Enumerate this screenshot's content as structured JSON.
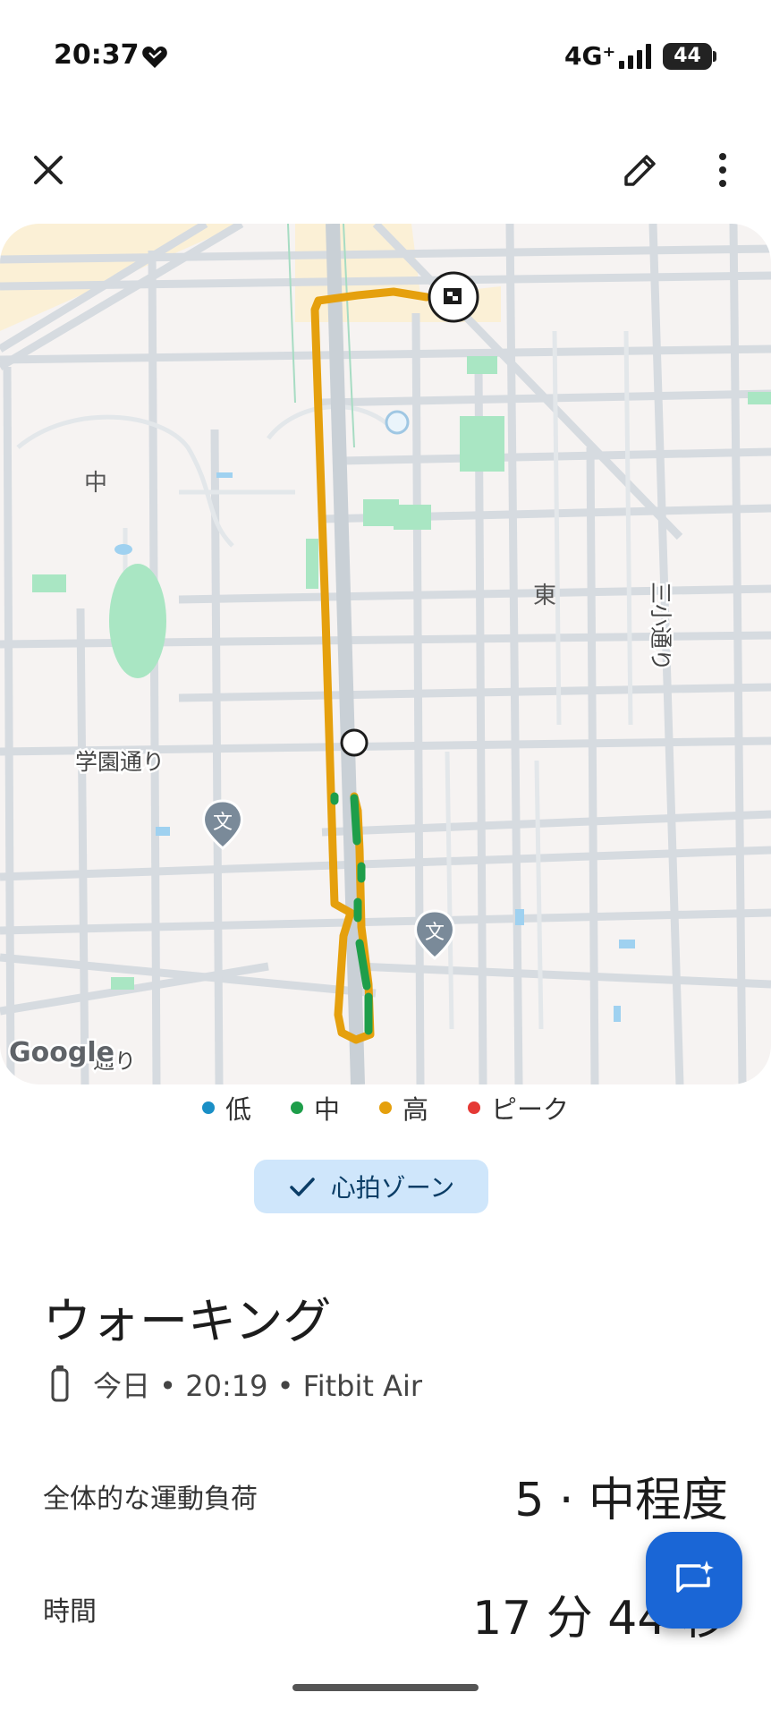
{
  "status_bar": {
    "time": "20:37",
    "network": "4G⁺",
    "battery": "44"
  },
  "toolbar": {
    "close_icon": "close-icon",
    "edit_icon": "pencil-icon",
    "more_icon": "more-vert-icon"
  },
  "map": {
    "labels": {
      "naka": "中",
      "higashi": "東",
      "gakuen_dori": "学園通り",
      "sanko_dori": "三小通り",
      "bottom_road": "通り",
      "google": "Google"
    },
    "school_icon": "文"
  },
  "legend": [
    {
      "label": "低",
      "color": "#1a8fc6"
    },
    {
      "label": "中",
      "color": "#1e9e4a"
    },
    {
      "label": "高",
      "color": "#e5a00d"
    },
    {
      "label": "ピーク",
      "color": "#e53935"
    }
  ],
  "zone_chip": {
    "label": "心拍ゾーン"
  },
  "activity": {
    "title": "ウォーキング",
    "meta": "今日 • 20:19 • Fitbit Air"
  },
  "stats": [
    {
      "label": "全体的な運動負荷",
      "value": "5 · 中程度"
    },
    {
      "label": "時間",
      "value": "17 分 44 秒"
    }
  ],
  "colors": {
    "route_high": "#e5a00d",
    "route_mid": "#1e9e4a",
    "fab": "#1a66d6",
    "chip": "#cfe6fb"
  }
}
